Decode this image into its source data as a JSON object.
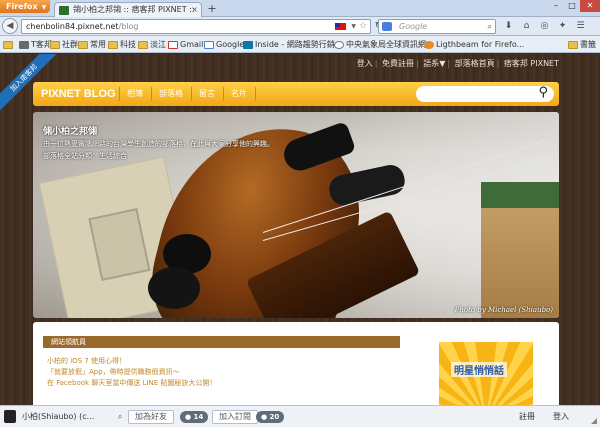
{
  "browser": {
    "menu_label": "Firefox",
    "tab_title": "㋿小柏之邦㋿ :: 痞客邦 PIXNET ::",
    "tab_close": "×",
    "new_tab": "+",
    "url_domain": "chenbolin84.pixnet.net",
    "url_path": "/blog",
    "search_placeholder": "Google",
    "win_min": "–",
    "win_max": "□",
    "win_close": "✕"
  },
  "bookmarks": [
    {
      "label": "T客邦",
      "icon": "folder"
    },
    {
      "label": "社群",
      "icon": "folder"
    },
    {
      "label": "常用",
      "icon": "folder"
    },
    {
      "label": "科技",
      "icon": "folder"
    },
    {
      "label": "淡江",
      "icon": "folder"
    },
    {
      "label": "Gmail",
      "icon": "gmail"
    },
    {
      "label": "Google",
      "icon": "google"
    },
    {
      "label": "Inside - 網路趨勢行銷...",
      "icon": "li"
    },
    {
      "label": "中央氣象局全球資訊網",
      "icon": "eye"
    },
    {
      "label": "Ligthbeam for Firefo...",
      "icon": "ff"
    },
    {
      "label": "書籤",
      "icon": "folder"
    }
  ],
  "site": {
    "ribbon": "加入痞客邦",
    "top_links": [
      "登入",
      "免費註冊",
      "語系▼",
      "部落格首頁",
      "痞客邦 PIXNET"
    ],
    "blog_name": "PIXNET BLOG",
    "menu": [
      "相簿",
      "部落格",
      "留言",
      "名片"
    ],
    "banner_title": "㋿小柏之邦㋿",
    "banner_desc": "由一位熱愛電腦網路的台灣學生創造的部落格，在此與大家分享他的興趣。",
    "banner_category": "部落格全站分類：生活綜合",
    "photo_credit": "Photo by Michael (Shiaubo)"
  },
  "panel": {
    "title": "網站領航員",
    "lines": [
      "小柏的 iOS 7 使用心得！",
      "「就要放假」App，帶時提供職務假資訊～",
      "在 Facebook 聊天室當中傳送 LINE 貼圖秘訣大公開！"
    ]
  },
  "ad": {
    "text": "明星悄悄話"
  },
  "statusbar": {
    "user": "小柏(Shiaubo) (c...",
    "add_friend": "加為好友",
    "friends_count": "14",
    "subscribe": "加入訂閱",
    "subscribers_count": "20",
    "register": "註冊",
    "login": "登入"
  }
}
